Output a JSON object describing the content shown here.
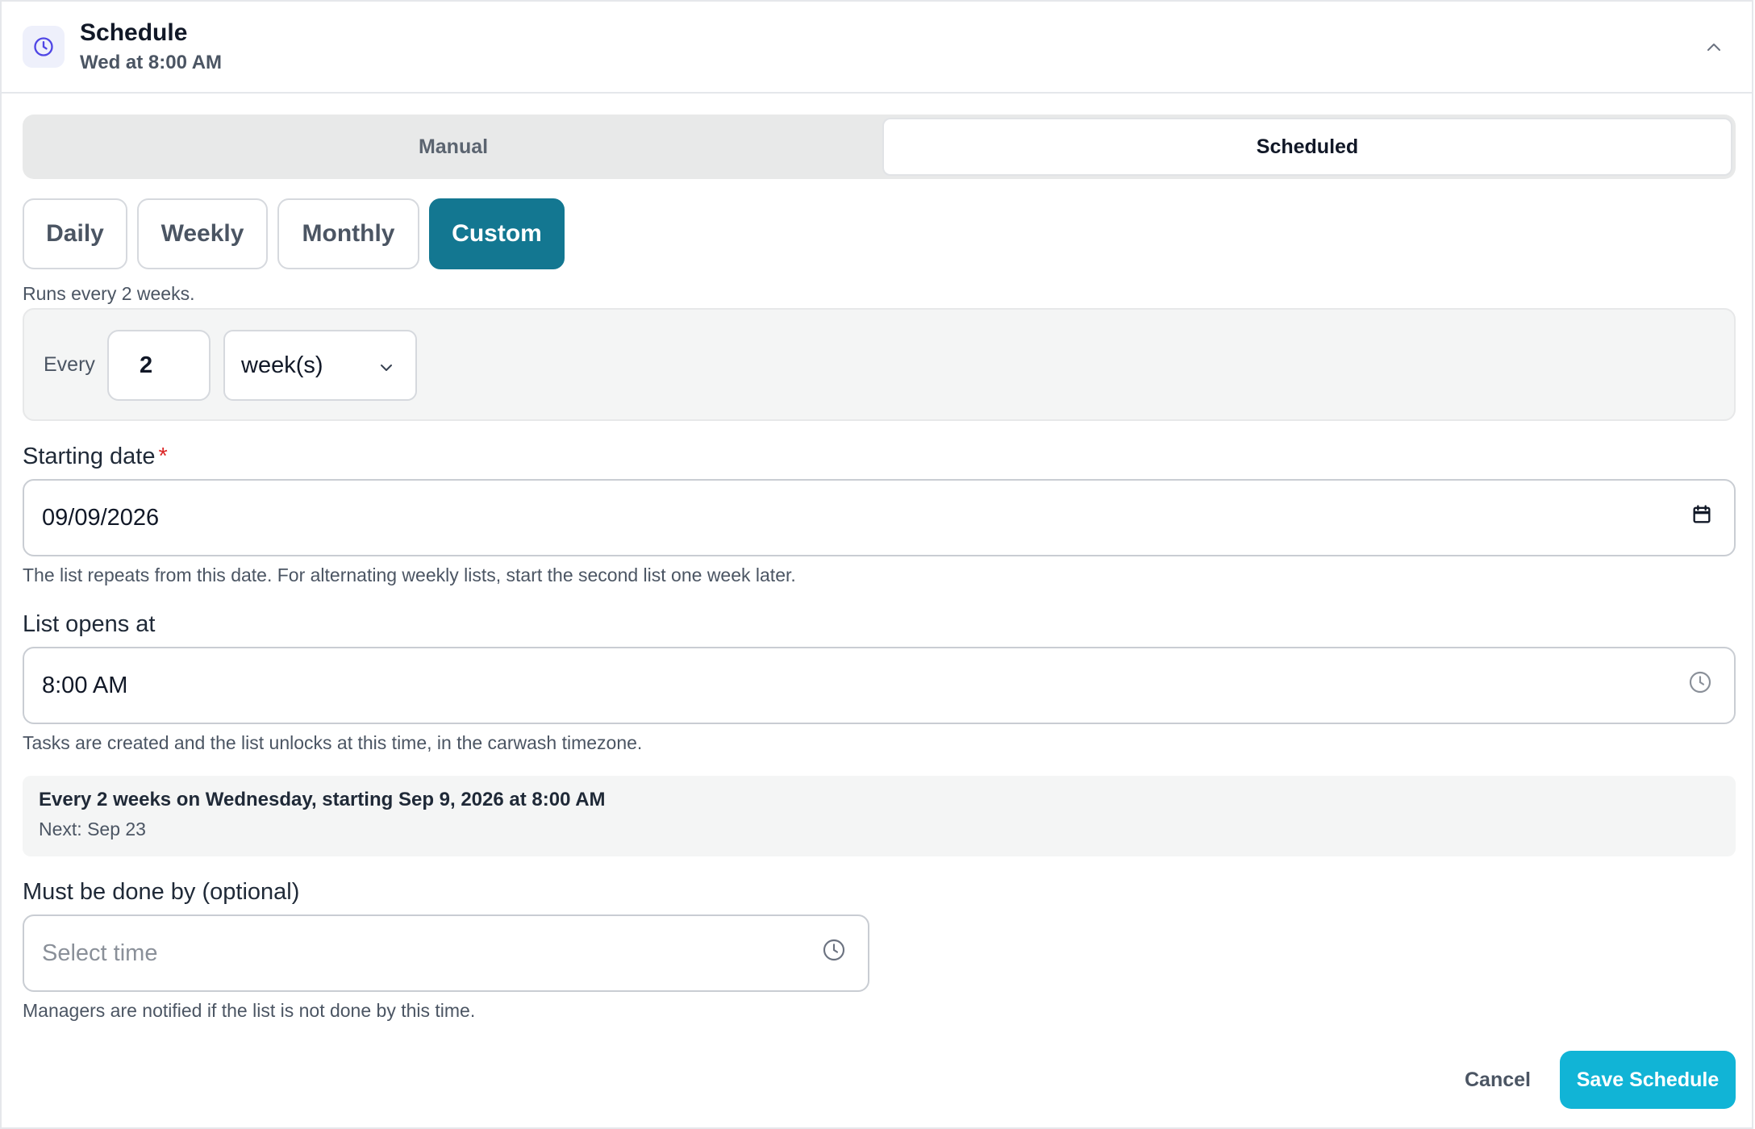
{
  "header": {
    "title": "Schedule",
    "subtitle": "Wed at 8:00 AM",
    "icon": "clock-icon",
    "collapse_icon": "chevron-up-icon"
  },
  "mode_tabs": [
    {
      "label": "Manual",
      "selected": false
    },
    {
      "label": "Scheduled",
      "selected": true
    }
  ],
  "frequency_options": [
    {
      "label": "Daily",
      "selected": false
    },
    {
      "label": "Weekly",
      "selected": false
    },
    {
      "label": "Monthly",
      "selected": false
    },
    {
      "label": "Custom",
      "selected": true
    }
  ],
  "runs_hint": "Runs every 2 weeks.",
  "interval": {
    "label": "Every",
    "value": "2",
    "unit": "week(s)"
  },
  "starting_date": {
    "label": "Starting date",
    "required_mark": "*",
    "value": "09/09/2026",
    "icon": "calendar-icon",
    "help": "The list repeats from this date. For alternating weekly lists, start the second list one week later."
  },
  "opens_at": {
    "label": "List opens at",
    "value": "8:00 AM",
    "icon": "clock-icon",
    "help": "Tasks are created and the list unlocks at this time, in the carwash timezone."
  },
  "summary": {
    "title": "Every 2 weeks on Wednesday, starting Sep 9, 2026 at 8:00 AM",
    "next": "Next: Sep 23"
  },
  "done_by": {
    "label": "Must be done by (optional)",
    "placeholder": "Select time",
    "icon": "clock-icon",
    "help": "Managers are notified if the list is not done by this time."
  },
  "actions": {
    "cancel_label": "Cancel",
    "save_label": "Save Schedule"
  },
  "colors": {
    "accent_active": "#137791",
    "save_button": "#11b4d6",
    "required": "#dc2626",
    "header_icon_bg": "#eef0fb",
    "header_icon": "#4f46e5"
  }
}
